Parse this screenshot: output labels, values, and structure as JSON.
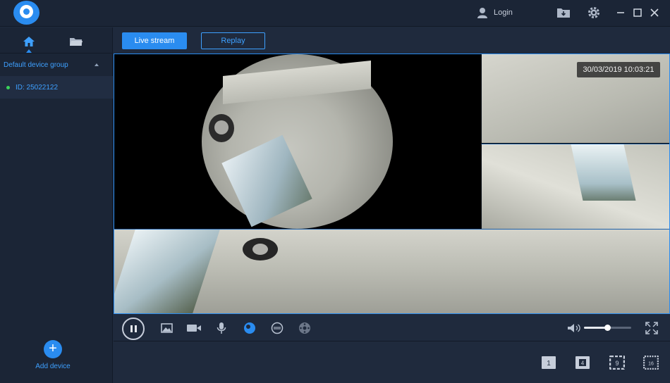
{
  "header": {
    "login_label": "Login"
  },
  "sidebar": {
    "group_label": "Default device group",
    "device_label": "ID: 25022122",
    "add_device_label": "Add device",
    "add_symbol": "+"
  },
  "tabs": {
    "live_label": "Live stream",
    "replay_label": "Replay",
    "active": "Live stream"
  },
  "video": {
    "timestamp": "30/03/2019 10:03:21"
  },
  "controls": {
    "volume_level": 0.45,
    "fisheye_mode_active": true
  },
  "layouts": {
    "one": "1",
    "four": "4",
    "nine": "9",
    "sixteen": "16"
  },
  "colors": {
    "accent": "#2a8cf0",
    "link": "#3ea0ff",
    "online": "#3ad35a",
    "background": "#1f2a3d"
  }
}
